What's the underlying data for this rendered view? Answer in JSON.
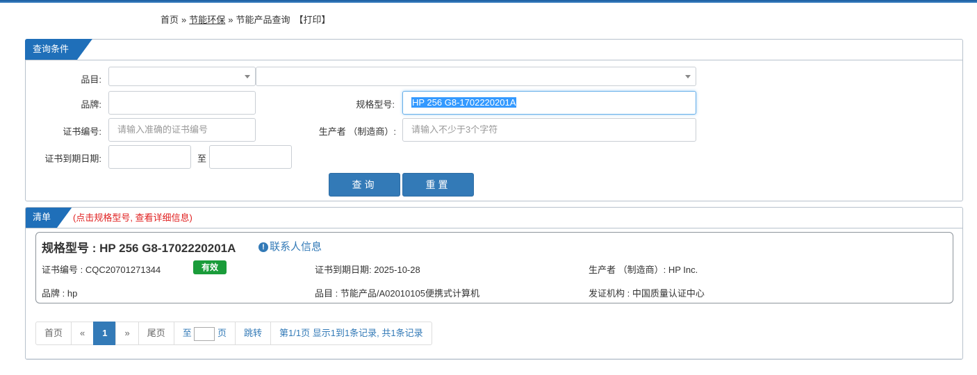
{
  "breadcrumb": {
    "home": "首页",
    "sep": "»",
    "section": "节能环保",
    "current": "节能产品查询",
    "print": "【打印】"
  },
  "query": {
    "title": "查询条件",
    "category_label": "品目:",
    "category_value": "",
    "category_sub_value": "",
    "brand_label": "品牌:",
    "brand_value": "",
    "model_label": "规格型号:",
    "model_value": "HP 256 G8-1702220201A",
    "cert_no_label": "证书编号:",
    "cert_no_placeholder": "请输入准确的证书编号",
    "manufacturer_label": "生产者 （制造商）:",
    "manufacturer_placeholder": "请输入不少于3个字符",
    "expiry_label": "证书到期日期:",
    "expiry_from": "",
    "to_label": "至",
    "expiry_to": "",
    "search_button": "查询",
    "reset_button": "重置"
  },
  "results": {
    "title": "清单",
    "hint": "(点击规格型号, 查看详细信息)",
    "items": [
      {
        "title": "规格型号 : HP 256 G8-1702220201A",
        "contact_link": "联系人信息",
        "cert_no": "证书编号 : CQC20701271344",
        "status": "有效",
        "expiry": "证书到期日期: 2025-10-28",
        "manufacturer": "生产者 （制造商）: HP Inc.",
        "brand": "品牌 : hp",
        "category": "品目 : 节能产品/A02010105便携式计算机",
        "issuer": "发证机构 : 中国质量认证中心"
      }
    ]
  },
  "pager": {
    "first": "首页",
    "prev": "«",
    "current": "1",
    "next": "»",
    "last": "尾页",
    "goto_prefix": "至",
    "goto_value": "",
    "goto_suffix": "页",
    "jump": "跳转",
    "summary": "第1/1页  显示1到1条记录, 共1条记录"
  },
  "colors": {
    "accent": "#1f6fb9",
    "button": "#337ab7",
    "valid_badge": "#1a9c3a",
    "hint_red": "#e02020"
  }
}
